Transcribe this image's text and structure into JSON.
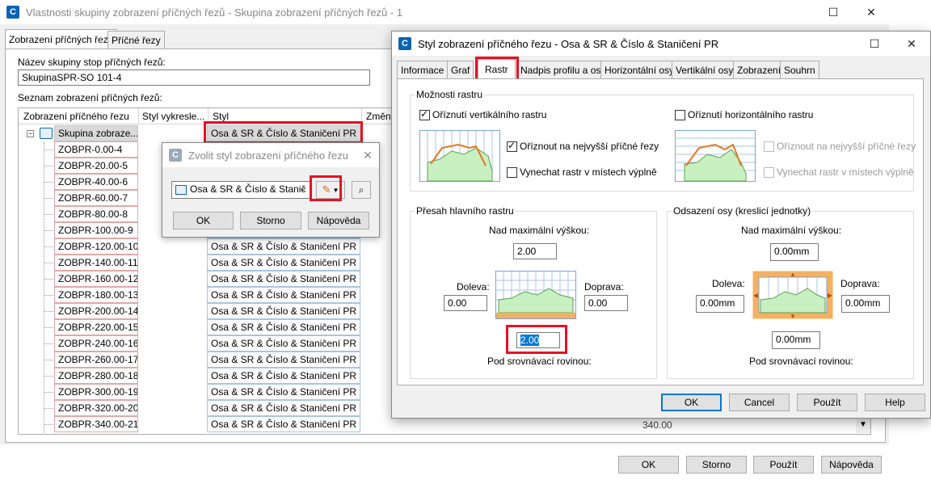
{
  "main": {
    "title": "Vlastnosti skupiny zobrazení příčných řezů - Skupina zobrazení příčných řezů - 1",
    "tabs": [
      "Zobrazení příčných řezů",
      "Příčné řezy"
    ],
    "group_name_label": "Název skupiny stop příčných řezů:",
    "group_name_value": "SkupinaSPR-SO 101-4",
    "list_label": "Seznam zobrazení příčných řezů:",
    "columns": [
      "Zobrazení příčného řezu",
      "Styl vykresle...",
      "Styl",
      "Změn"
    ],
    "root_row": {
      "name": "Skupina zobraze...",
      "style": "Osa & SR & Číslo & Staničení PR"
    },
    "rows": [
      {
        "name": "ZOBPR-0.00-4",
        "style": ""
      },
      {
        "name": "ZOBPR-20.00-5",
        "style": ""
      },
      {
        "name": "ZOBPR-40.00-6",
        "style": ""
      },
      {
        "name": "ZOBPR-60.00-7",
        "style": ""
      },
      {
        "name": "ZOBPR-80.00-8",
        "style": ""
      },
      {
        "name": "ZOBPR-100.00-9",
        "style": ""
      },
      {
        "name": "ZOBPR-120.00-10",
        "style": "Osa & SR & Číslo & Staničení PR"
      },
      {
        "name": "ZOBPR-140.00-11",
        "style": "Osa & SR & Číslo & Staničení PR"
      },
      {
        "name": "ZOBPR-160.00-12",
        "style": "Osa & SR & Číslo & Staničení PR"
      },
      {
        "name": "ZOBPR-180.00-13",
        "style": "Osa & SR & Číslo & Staničení PR"
      },
      {
        "name": "ZOBPR-200.00-14",
        "style": "Osa & SR & Číslo & Staničení PR"
      },
      {
        "name": "ZOBPR-220.00-15",
        "style": "Osa & SR & Číslo & Staničení PR"
      },
      {
        "name": "ZOBPR-240.00-16",
        "style": "Osa & SR & Číslo & Staničení PR"
      },
      {
        "name": "ZOBPR-260.00-17",
        "style": "Osa & SR & Číslo & Staničení PR"
      },
      {
        "name": "ZOBPR-280.00-18",
        "style": "Osa & SR & Číslo & Staničení PR"
      },
      {
        "name": "ZOBPR-300.00-19",
        "style": "Osa & SR & Číslo & Staničení PR"
      },
      {
        "name": "ZOBPR-320.00-20",
        "style": "Osa & SR & Číslo & Staničení PR"
      },
      {
        "name": "ZOBPR-340.00-21",
        "style": "Osa & SR & Číslo & Staničení PR"
      }
    ],
    "last_row_value": "340.00",
    "buttons": {
      "ok": "OK",
      "cancel": "Storno",
      "apply": "Použít",
      "help": "Nápověda"
    }
  },
  "picker": {
    "title": "Zvolit styl zobrazení příčného řezu",
    "selected": "Osa & SR & Číslo & Stanič",
    "buttons": {
      "ok": "OK",
      "cancel": "Storno",
      "help": "Nápověda"
    }
  },
  "style_dialog": {
    "title": "Styl zobrazení příčného řezu - Osa & SR & Číslo & Staničení PR",
    "tabs": [
      "Informace",
      "Graf",
      "Rastr",
      "Nadpis profilu a osy",
      "Horizontální osy",
      "Vertikální osy",
      "Zobrazení",
      "Souhrn"
    ],
    "grid_options": {
      "label": "Možnosti rastru",
      "clip_vertical": "Oříznutí vertikálního rastru",
      "clip_horizontal": "Oříznutí horizontálního rastru",
      "clip_highest_left": "Oříznout na nejvyšší příčné řezy",
      "omit_left": "Vynechat rastr v místech výplně",
      "clip_highest_right": "Oříznout na nejvyšší příčné řezy",
      "omit_right": "Vynechat rastr v místech výplně"
    },
    "grid_padding": {
      "label": "Přesah hlavního rastru",
      "above_label": "Nad maximální výškou:",
      "above": "2.00",
      "left_label": "Doleva:",
      "left": "0.00",
      "right_label": "Doprava:",
      "right": "0.00",
      "below": "2.00",
      "below_label": "Pod srovnávací rovinou:"
    },
    "axis_offset": {
      "label": "Odsazení osy (kreslicí jednotky)",
      "above_label": "Nad maximální výškou:",
      "above": "0.00mm",
      "left_label": "Doleva:",
      "left": "0.00mm",
      "right_label": "Doprava:",
      "right": "0.00mm",
      "below": "0.00mm",
      "below_label": "Pod srovnávací rovinou:"
    },
    "buttons": {
      "ok": "OK",
      "cancel": "Cancel",
      "apply": "Použít",
      "help": "Help"
    }
  },
  "colors": {
    "accent": "#0078d7",
    "highlight": "#e81123",
    "grid_fill": "#c8f0c0",
    "grid_line": "#e87722"
  }
}
